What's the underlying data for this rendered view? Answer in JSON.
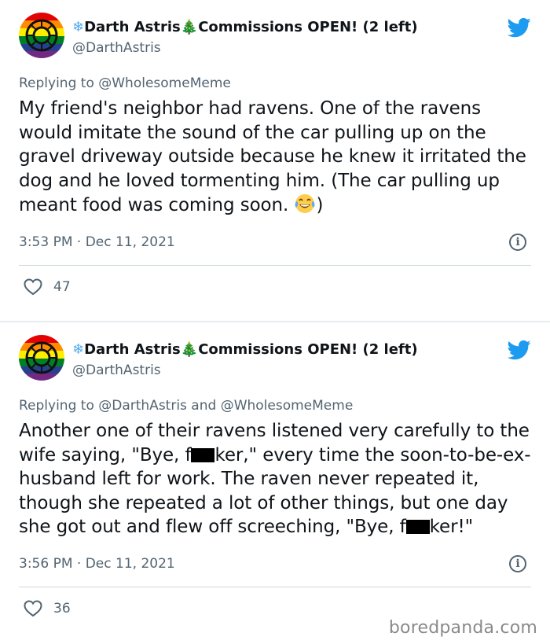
{
  "tweets": [
    {
      "display_name": "Darth Astris",
      "name_suffix": "Commissions OPEN! (2 left)",
      "handle": "@DarthAstris",
      "reply_prefix": "Replying to ",
      "reply_to": "@WholesomeMeme",
      "text": "My friend's neighbor had ravens. One of the ravens would imitate the sound of the car pulling up on the gravel driveway outside because he knew it irritated the dog and he loved tormenting him. (The car pulling up meant food was coming soon. ",
      "text_end": ")",
      "timestamp": "3:53 PM · Dec 11, 2021",
      "likes": "47"
    },
    {
      "display_name": "Darth Astris",
      "name_suffix": "Commissions OPEN! (2 left)",
      "handle": "@DarthAstris",
      "reply_prefix": "Replying to ",
      "reply_to": "@DarthAstris and @WholesomeMeme",
      "text_a": "Another one of their ravens listened very carefully to the wife saying, \"Bye, f",
      "text_b": "ker,\" every time the soon-to-be-ex-husband left for work. The raven never repeated it, though she repeated a lot of other things, but one day she got out and flew off screeching, \"Bye, f",
      "text_c": "ker!\"",
      "timestamp": "3:56 PM · Dec 11, 2021",
      "likes": "36"
    }
  ],
  "icons": {
    "snowflake": "❄",
    "tree": "🎄",
    "info": "i"
  },
  "watermark": "boredpanda.com",
  "colors": {
    "twitter_blue": "#1d9bf0",
    "secondary_text": "#536471"
  }
}
